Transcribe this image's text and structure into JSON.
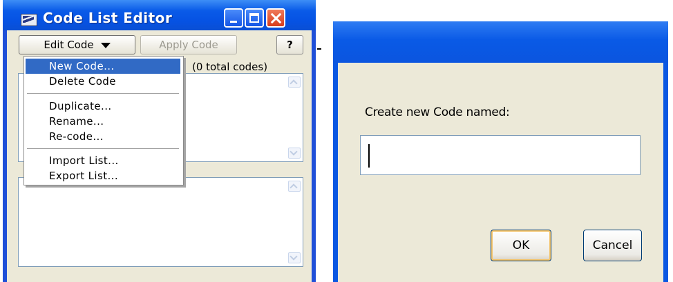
{
  "left_window": {
    "title": "Code List Editor",
    "toolbar": {
      "edit_code_label": "Edit Code",
      "apply_code_label": "Apply Code",
      "help_label": "?"
    },
    "count_label": "(0 total codes)",
    "menu": {
      "items": [
        {
          "label": "New Code...",
          "selected": true
        },
        {
          "label": "Delete Code"
        },
        {
          "label": "Duplicate..."
        },
        {
          "label": "Rename..."
        },
        {
          "label": "Re-code..."
        },
        {
          "label": "Import List..."
        },
        {
          "label": "Export List..."
        }
      ]
    }
  },
  "dialog": {
    "prompt": "Create new Code named:",
    "input_value": "",
    "ok_label": "OK",
    "cancel_label": "Cancel"
  },
  "colors": {
    "titlebar": "#0a5be8",
    "menu_highlight": "#316ac5",
    "window_face": "#ece9d8",
    "close_button": "#d63d1c"
  }
}
